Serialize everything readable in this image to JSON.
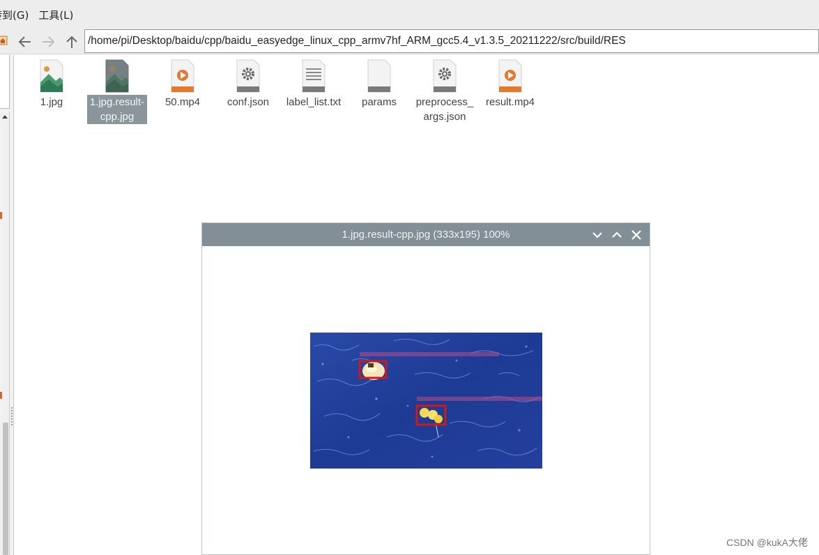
{
  "menubar": {
    "items": [
      "转到(G)",
      "工具(L)"
    ]
  },
  "toolbar": {
    "home_icon": "home-icon",
    "back_icon": "arrow-left-icon",
    "forward_icon": "arrow-right-icon",
    "up_icon": "arrow-up-icon",
    "path": "/home/pi/Desktop/baidu/cpp/baidu_easyedge_linux_cpp_armv7hf_ARM_gcc5.4_v1.3.5_20211222/src/build/RES"
  },
  "files": [
    {
      "name": "1.jpg",
      "icon": "image-file-icon",
      "selected": false
    },
    {
      "name": "1.jpg.result-cpp.jpg",
      "name_lines": [
        "1.jpg.result-",
        "cpp.jpg"
      ],
      "icon": "image-file-icon",
      "selected": true
    },
    {
      "name": "50.mp4",
      "icon": "video-file-icon",
      "selected": false
    },
    {
      "name": "conf.json",
      "icon": "settings-file-icon",
      "selected": false
    },
    {
      "name": "label_list.txt",
      "icon": "text-file-icon",
      "selected": false
    },
    {
      "name": "params",
      "icon": "blank-file-icon",
      "selected": false
    },
    {
      "name": "preprocess_args.json",
      "name_lines": [
        "preprocess_",
        "args.json"
      ],
      "icon": "settings-file-icon",
      "selected": false
    },
    {
      "name": "result.mp4",
      "icon": "video-file-icon",
      "selected": false
    }
  ],
  "viewer": {
    "title": "1.jpg.result-cpp.jpg (333x195) 100%",
    "minimize_icon": "chevron-down-icon",
    "maximize_icon": "chevron-up-icon",
    "close_icon": "close-icon",
    "image": "detection-result-photo"
  },
  "watermark": "CSDN @kukA大佬",
  "colors": {
    "menubar_bg": "#ededed",
    "titlebar_bg": "#838f96",
    "selection_bg": "#8a969c",
    "ocean_blue": "#1f3f9a",
    "detection_box": "#d01818"
  }
}
